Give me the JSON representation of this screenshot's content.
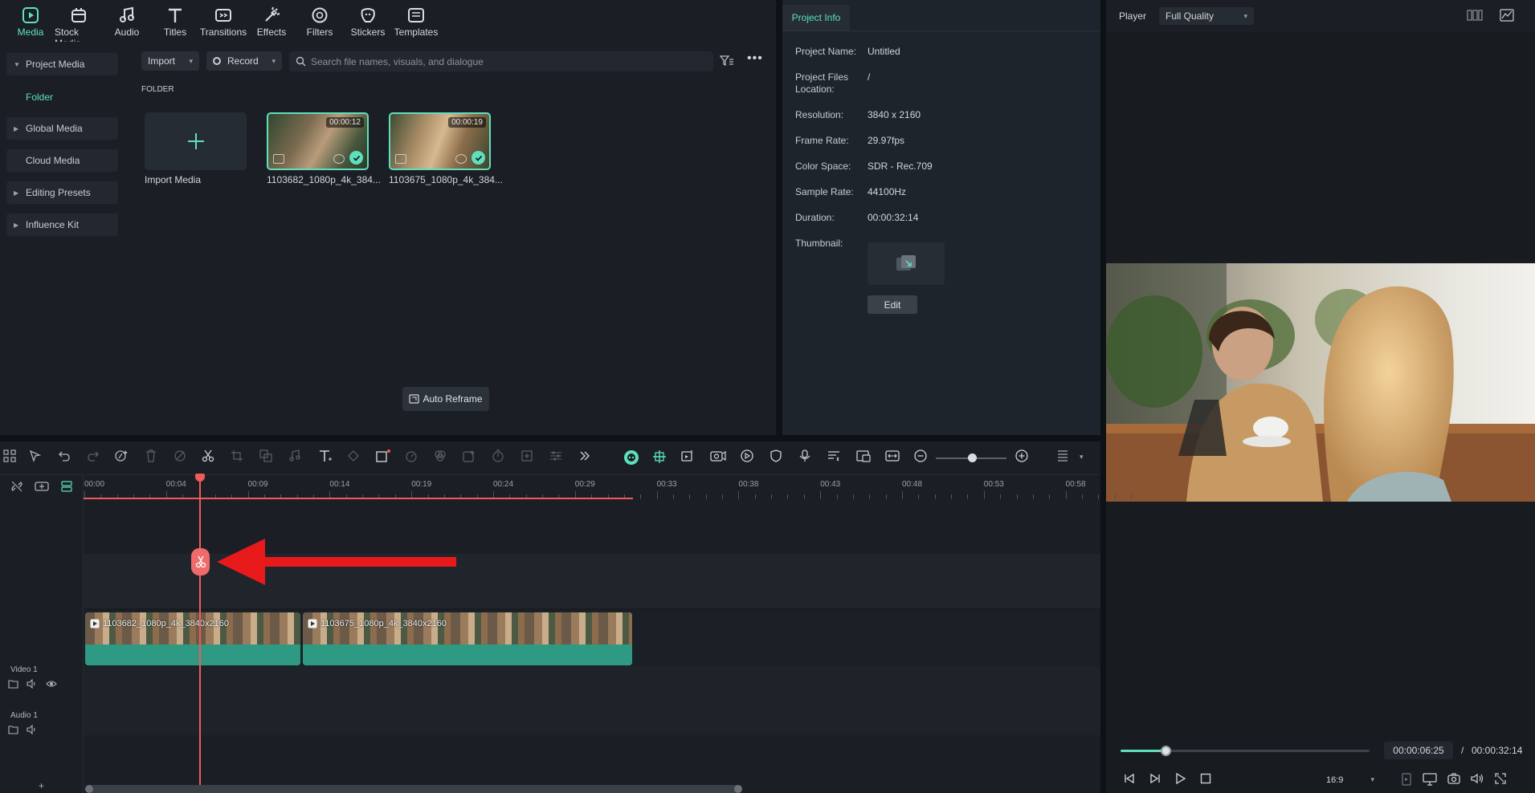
{
  "categories": [
    {
      "label": "Media",
      "icon": "media-icon",
      "active": true
    },
    {
      "label": "Stock Media",
      "icon": "stock-media-icon"
    },
    {
      "label": "Audio",
      "icon": "audio-icon"
    },
    {
      "label": "Titles",
      "icon": "titles-icon"
    },
    {
      "label": "Transitions",
      "icon": "transitions-icon"
    },
    {
      "label": "Effects",
      "icon": "effects-icon"
    },
    {
      "label": "Filters",
      "icon": "filters-icon"
    },
    {
      "label": "Stickers",
      "icon": "stickers-icon"
    },
    {
      "label": "Templates",
      "icon": "templates-icon"
    }
  ],
  "sidebar": {
    "project_media": "Project Media",
    "folder": "Folder",
    "global_media": "Global Media",
    "cloud_media": "Cloud Media",
    "editing_presets": "Editing Presets",
    "influence_kit": "Influence Kit"
  },
  "media": {
    "import_label": "Import",
    "record_label": "Record",
    "search_placeholder": "Search file names, visuals, and dialogue",
    "folder_heading": "FOLDER",
    "import_media_label": "Import Media",
    "items": [
      {
        "name": "1103682_1080p_4k_384...",
        "duration": "00:00:12"
      },
      {
        "name": "1103675_1080p_4k_384...",
        "duration": "00:00:19"
      }
    ],
    "auto_reframe": "Auto Reframe"
  },
  "project_info": {
    "tab": "Project Info",
    "rows": [
      {
        "label": "Project Name:",
        "value": "Untitled"
      },
      {
        "label": "Project Files Location:",
        "value": "/"
      },
      {
        "label": "Resolution:",
        "value": "3840 x 2160"
      },
      {
        "label": "Frame Rate:",
        "value": "29.97fps"
      },
      {
        "label": "Color Space:",
        "value": "SDR - Rec.709"
      },
      {
        "label": "Sample Rate:",
        "value": "44100Hz"
      },
      {
        "label": "Duration:",
        "value": "00:00:32:14"
      }
    ],
    "thumbnail_label": "Thumbnail:",
    "edit_label": "Edit"
  },
  "player": {
    "title": "Player",
    "quality": "Full Quality",
    "current_time": "00:00:06:25",
    "separator": "/",
    "total_time": "00:00:32:14",
    "progress": 0.18,
    "aspect": "16:9"
  },
  "timeline": {
    "ruler": [
      "00:00",
      "00:04",
      "00:09",
      "00:14",
      "00:19",
      "00:24",
      "00:29",
      "00:33",
      "00:38",
      "00:43",
      "00:48",
      "00:53",
      "00:58"
    ],
    "tracks": {
      "video": "Video 1",
      "audio": "Audio 1"
    },
    "clips": [
      {
        "label": "1103682_1080p_4k_3840x2160"
      },
      {
        "label": "1103675_1080p_4k_3840x2160"
      }
    ]
  },
  "colors": {
    "accent": "#5ee0bd",
    "playhead": "#f05a5a",
    "annotation_arrow": "#e8191b",
    "clip": "#2f9a84"
  }
}
